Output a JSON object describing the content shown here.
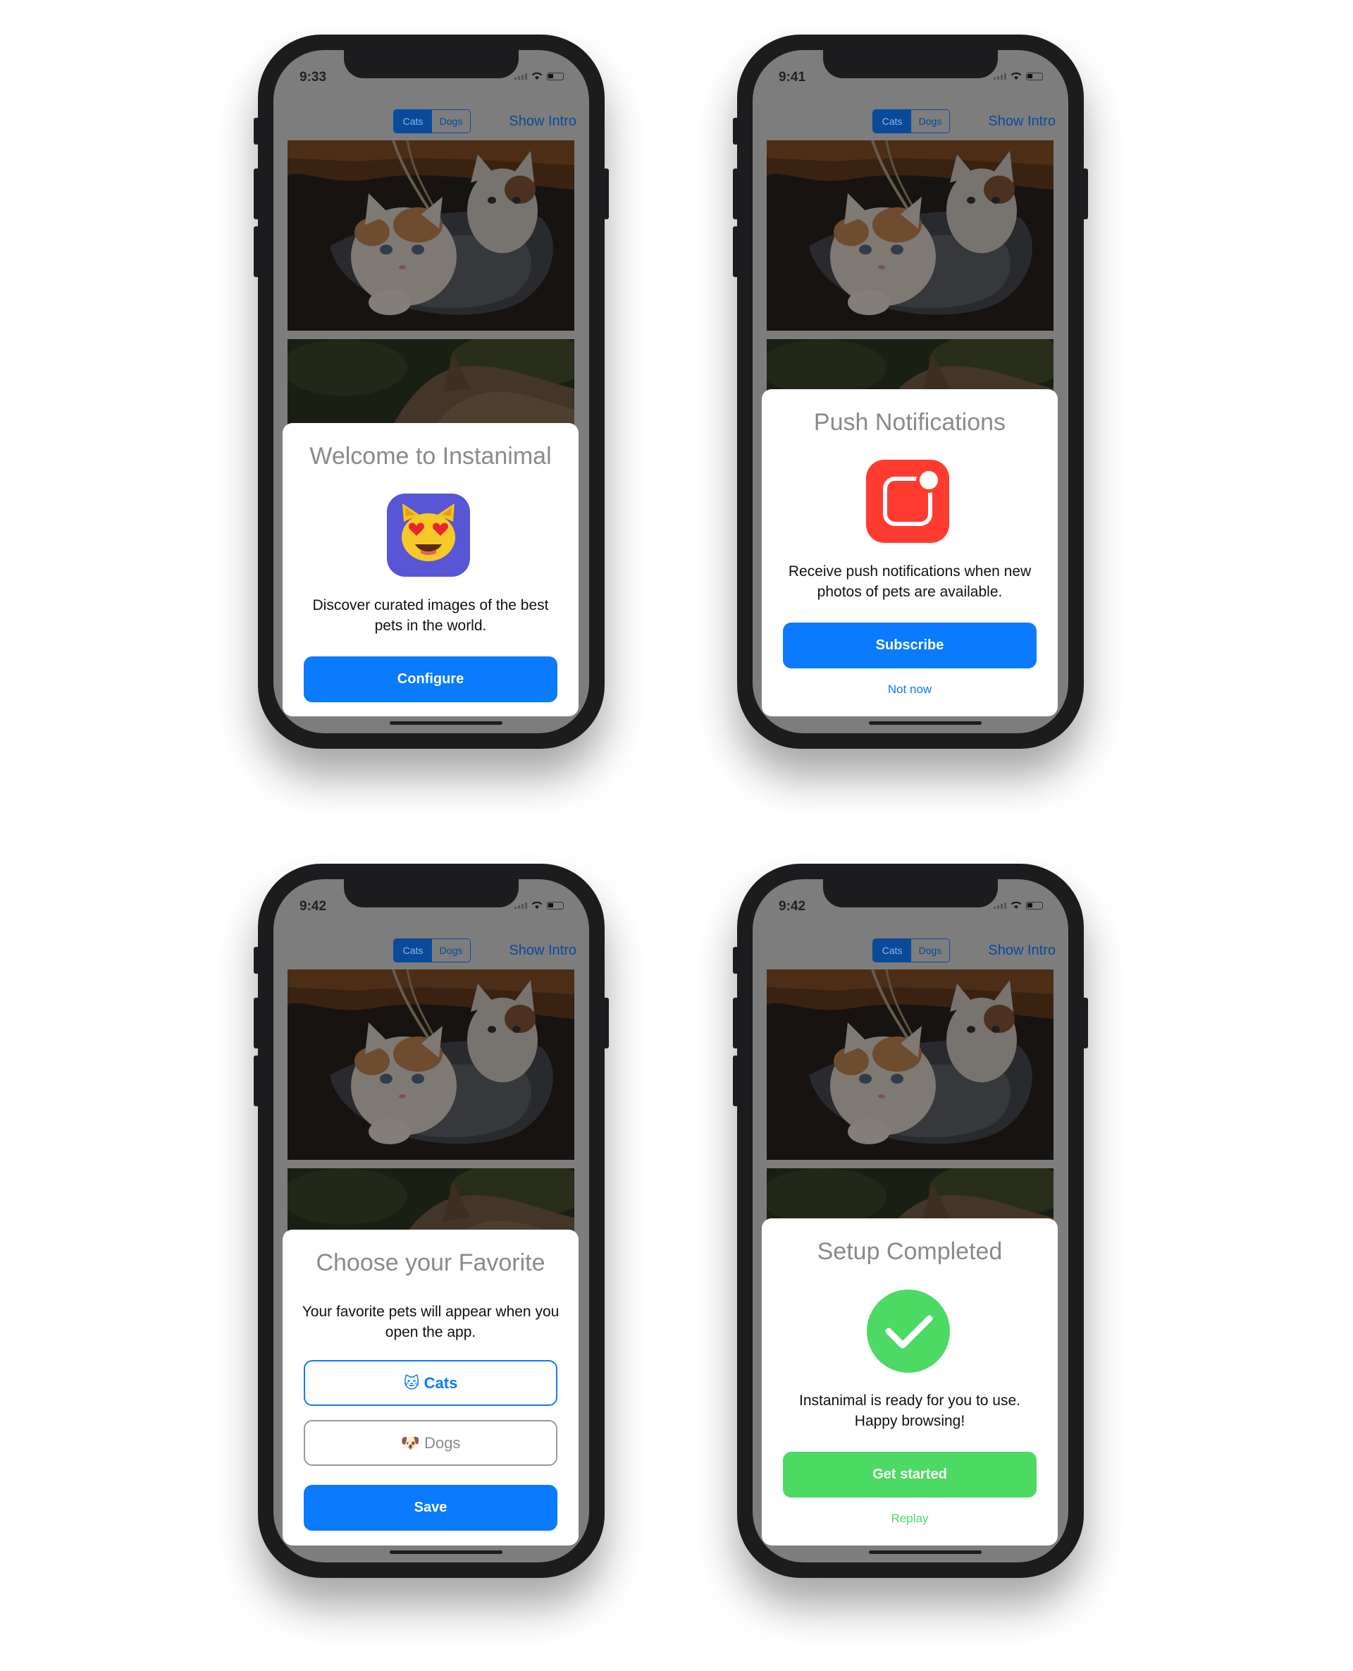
{
  "colors": {
    "accent": "#0a7aff",
    "success": "#4cd964",
    "notification_red": "#ff3b30",
    "app_icon_purple": "#5856d6"
  },
  "common": {
    "cats_segment": "Cats",
    "dogs_segment": "Dogs",
    "show_intro": "Show Intro"
  },
  "phones": [
    {
      "time": "9:33",
      "title": "Welcome to Instanimal",
      "icon": "cat-heart-eyes-emoji-icon",
      "body": "Discover curated images of the best pets in the world.",
      "primary_button": "Configure"
    },
    {
      "time": "9:41",
      "title": "Push Notifications",
      "icon": "notification-badge-icon",
      "body": "Receive push notifications when new photos of pets are available.",
      "primary_button": "Subscribe",
      "secondary_link": "Not now"
    },
    {
      "time": "9:42",
      "title": "Choose your Favorite",
      "body": "Your favorite pets will appear when you open the app.",
      "option_cats": "🐱 Cats",
      "option_dogs": "🐶 Dogs",
      "primary_button": "Save"
    },
    {
      "time": "9:42",
      "title": "Setup Completed",
      "icon": "checkmark-circle-icon",
      "body": "Instanimal is ready for you to use. Happy browsing!",
      "primary_button": "Get started",
      "secondary_link": "Replay"
    }
  ]
}
